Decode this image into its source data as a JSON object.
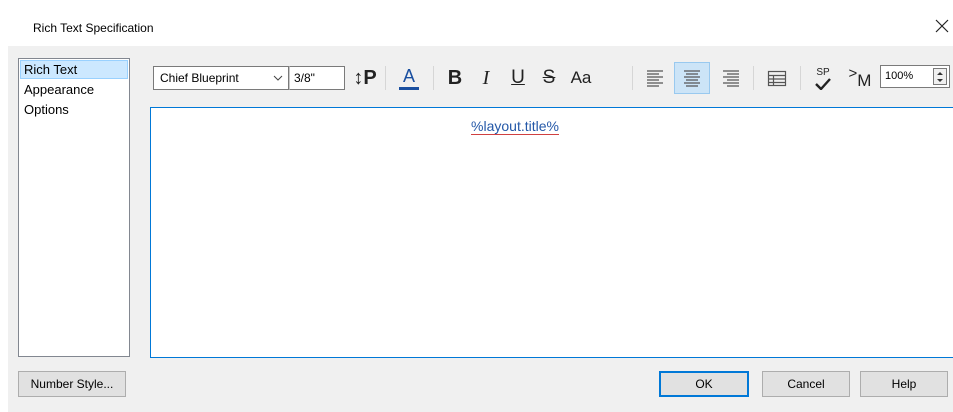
{
  "window": {
    "title": "Rich Text Specification",
    "close_icon": "close-icon"
  },
  "nav": {
    "items": [
      {
        "label": "Rich Text",
        "selected": true
      },
      {
        "label": "Appearance",
        "selected": false
      },
      {
        "label": "Options",
        "selected": false
      }
    ]
  },
  "toolbar": {
    "font": "Chief Blueprint",
    "size": "3/8\"",
    "line_spacing_label": "↕P",
    "text_color_label": "A",
    "bold_label": "B",
    "italic_label": "I",
    "underline_label": "U",
    "strike_label": "S",
    "case_label": "Aa",
    "spell_label": "SP",
    "macro_label": "M",
    "zoom": "100%",
    "text_color": "#1a4fa0",
    "align_center_active": true
  },
  "editor": {
    "content": "%layout.title%"
  },
  "buttons": {
    "number_style": "Number Style...",
    "ok": "OK",
    "cancel": "Cancel",
    "help": "Help"
  }
}
